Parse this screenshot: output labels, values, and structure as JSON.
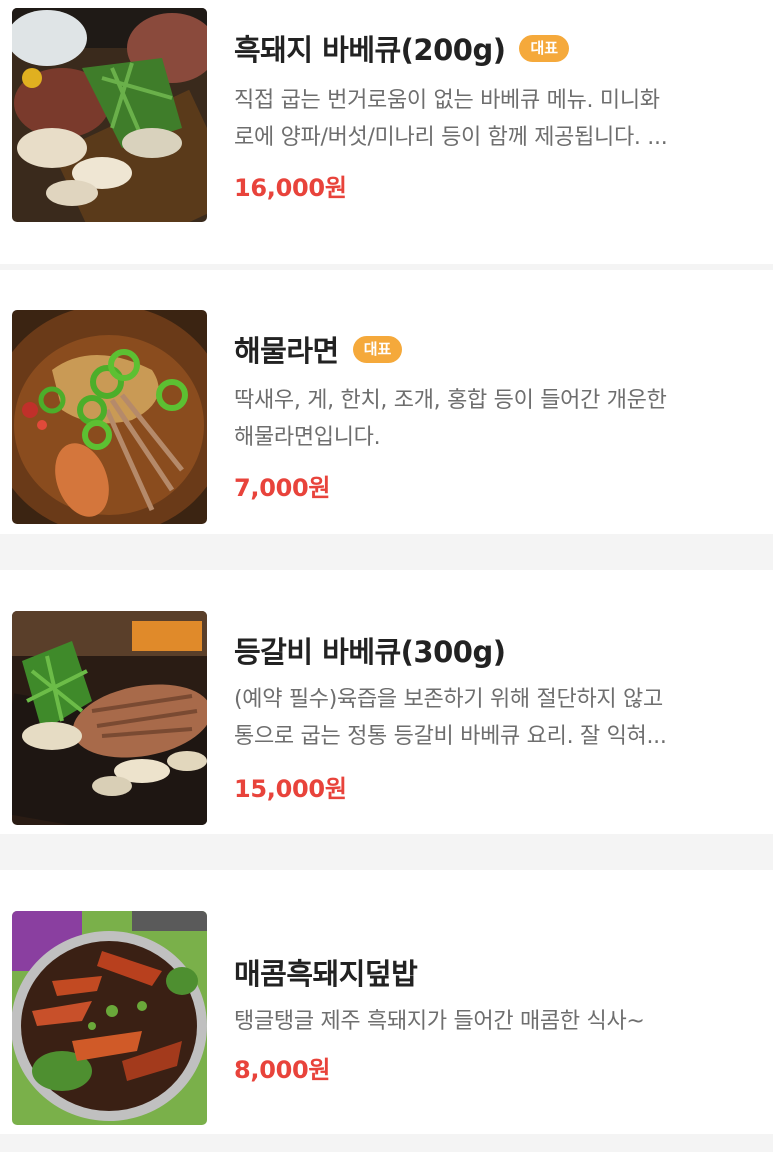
{
  "items": [
    {
      "name": "흑돼지 바베큐(200g)",
      "badge": "대표",
      "desc_line1": "직접 굽는 번거로움이 없는 바베큐 메뉴. 미니화",
      "desc_line2": "로에 양파/버섯/미나리 등이 함께 제공됩니다. ...",
      "price": "16,000원",
      "image": "bbq-pork-photo"
    },
    {
      "name": "해물라면",
      "badge": "대표",
      "desc_line1": "딱새우, 게, 한치, 조개, 홍합 등이 들어간 개운한",
      "desc_line2": "해물라면입니다.",
      "price": "7,000원",
      "image": "seafood-ramen-photo"
    },
    {
      "name": "등갈비 바베큐(300g)",
      "badge": "",
      "desc_line1": "(예약 필수)육즙을 보존하기 위해 절단하지 않고",
      "desc_line2": "통으로 굽는 정통 등갈비 바베큐 요리. 잘 익혀...",
      "price": "15,000원",
      "image": "pork-ribs-photo"
    },
    {
      "name": "매콤흑돼지덮밥",
      "badge": "",
      "desc_line1": "탱글탱글 제주 흑돼지가 들어간 매콤한 식사~",
      "desc_line2": "",
      "price": "8,000원",
      "image": "spicy-pork-rice-bowl-photo"
    }
  ],
  "colors": {
    "price": "#e8433b",
    "badge": "#f5a93b",
    "name": "#222222",
    "desc": "#6e6e6e",
    "separator": "#f4f4f4"
  }
}
